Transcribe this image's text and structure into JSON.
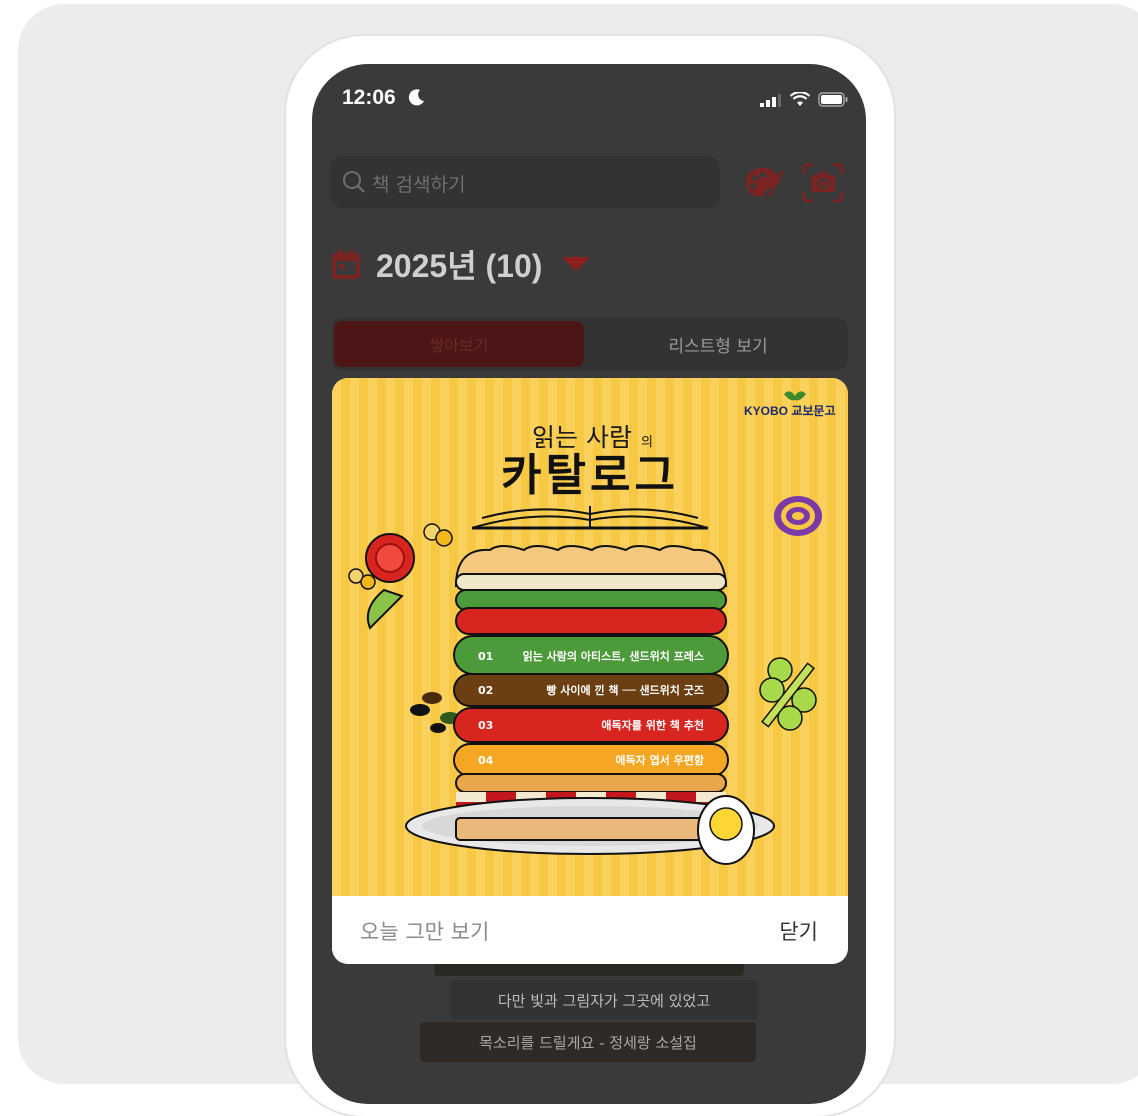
{
  "status_bar": {
    "time": "12:06"
  },
  "search": {
    "placeholder": "책 검색하기"
  },
  "year_selector": {
    "label": "2025년 (10)"
  },
  "view_tabs": {
    "stack": "쌓아보기",
    "list": "리스트형 보기"
  },
  "background_books": [
    "다만 빛과 그림자가 그곳에 있었고",
    "목소리를 드릴게요 - 정세랑 소설집"
  ],
  "popup": {
    "brand": "KYOBO 교보문고",
    "headline_top": "읽는 사람",
    "headline_suffix": "의",
    "headline_main": "카탈로그",
    "layers": [
      {
        "num": "01",
        "text": "읽는 사람의 아티스트, 샌드위치 프레스"
      },
      {
        "num": "02",
        "text": "빵 사이에 낀 책 ── 샌드위치 굿즈"
      },
      {
        "num": "03",
        "text": "애독자를 위한 책 추천"
      },
      {
        "num": "04",
        "text": "애독자 엽서 우편함"
      }
    ],
    "dont_show_today": "오늘 그만 보기",
    "close": "닫기"
  },
  "colors": {
    "accent": "#c0262f",
    "banner_yellow": "#f7c843",
    "screen_bg": "#3a3a3a"
  }
}
